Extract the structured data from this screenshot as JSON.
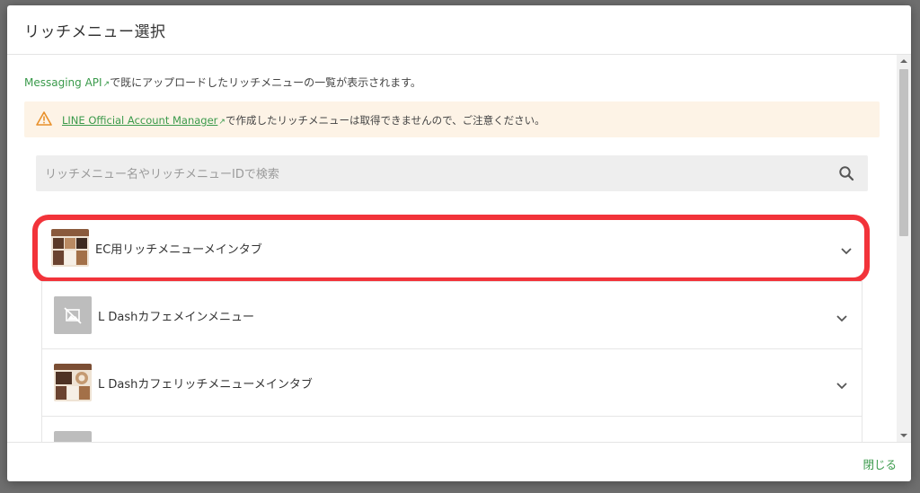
{
  "modal": {
    "title": "リッチメニュー選択"
  },
  "intro": {
    "link_text": "Messaging API",
    "text": "で既にアップロードしたリッチメニューの一覧が表示されます。"
  },
  "warning": {
    "link_text": "LINE Official Account Manager",
    "text": "で作成したリッチメニューは取得できませんので、ご注意ください。",
    "icon": "warning-icon",
    "color": "#fdf3e6"
  },
  "search": {
    "placeholder": "リッチメニュー名やリッチメニューIDで検索",
    "value": ""
  },
  "menus": [
    {
      "label": "EC用リッチメニューメインタブ",
      "thumbnail": "image",
      "highlighted": true
    },
    {
      "label": "L Dashカフェメインメニュー",
      "thumbnail": "no-image-icon",
      "highlighted": false
    },
    {
      "label": "L Dashカフェリッチメニューメインタブ",
      "thumbnail": "image",
      "highlighted": false
    },
    {
      "label": "",
      "thumbnail": "placeholder",
      "highlighted": false
    }
  ],
  "footer": {
    "close_label": "閉じる"
  },
  "colors": {
    "accent": "#3a9a4b",
    "highlight": "#f2333a"
  }
}
